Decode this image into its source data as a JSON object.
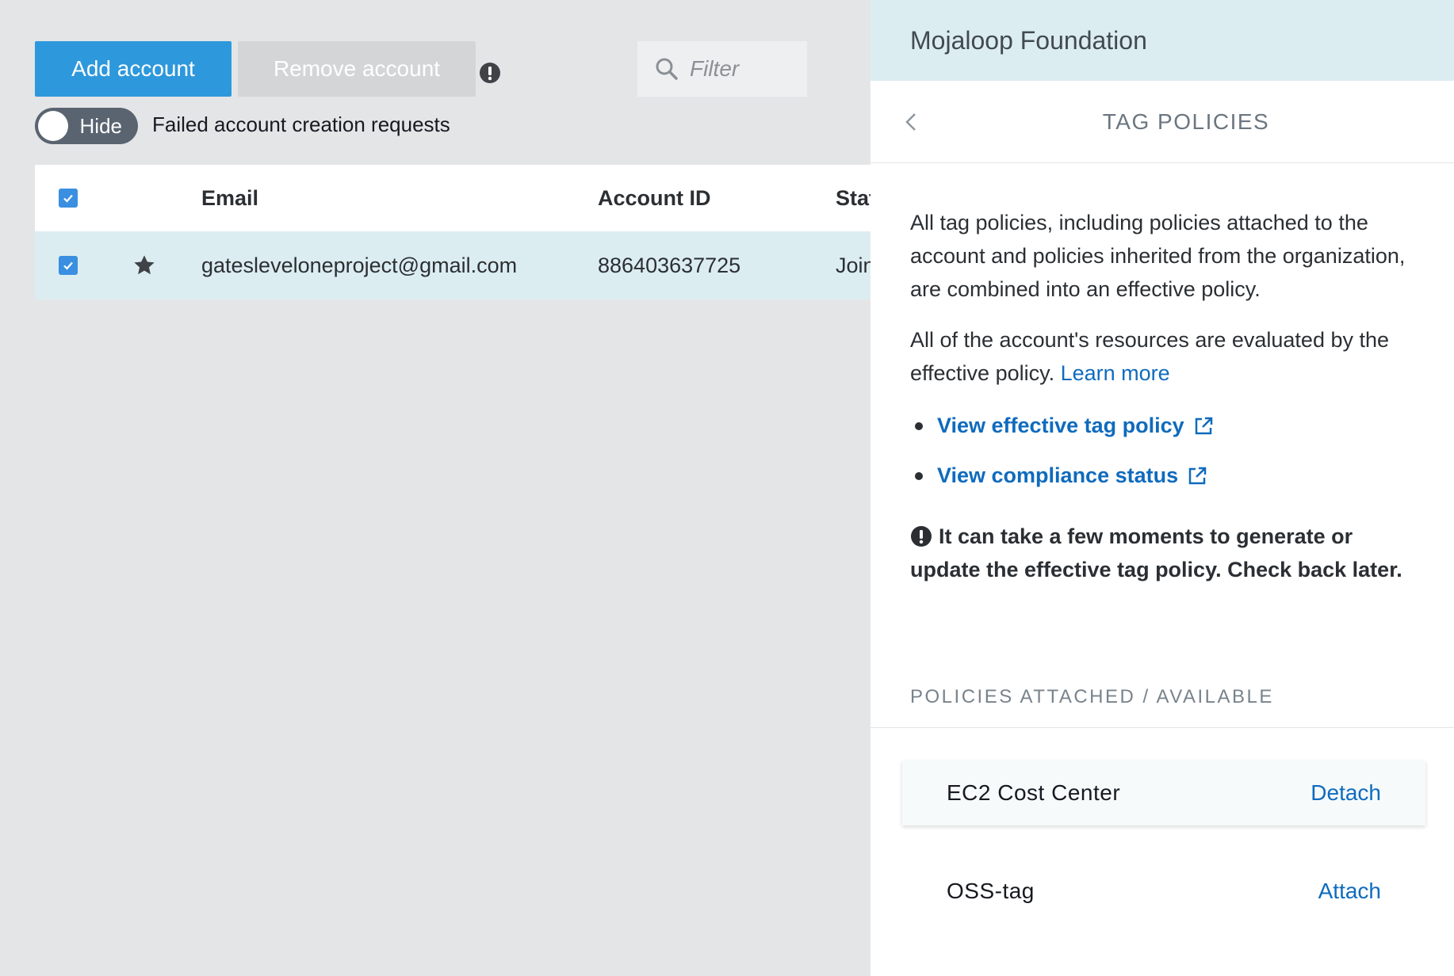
{
  "toolbar": {
    "add_label": "Add account",
    "remove_label": "Remove account",
    "filter_placeholder": "Filter"
  },
  "toggle": {
    "state_label": "Hide",
    "description": "Failed account creation requests"
  },
  "table": {
    "columns": [
      "Email",
      "Account ID",
      "Stat"
    ],
    "rows": [
      {
        "email": "gateslevelоneproject@gmail.com",
        "account_id": "886403637725",
        "status": "Join",
        "selected": true,
        "starred": true
      }
    ]
  },
  "panel": {
    "org_name": "Mojaloop Foundation",
    "title": "TAG POLICIES",
    "para1": "All tag policies, including policies attached to the account and policies inherited from the organization, are combined into an effective policy.",
    "para2": "All of the account's resources are evaluated by the effective policy.",
    "learn_more": "Learn more",
    "links": [
      "View effective tag policy",
      "View compliance status"
    ],
    "note": "It can take a few moments to generate or update the effective tag policy. Check back later.",
    "section_label": "POLICIES ATTACHED / AVAILABLE",
    "policies": [
      {
        "name": "EC2 Cost Center",
        "action": "Detach"
      },
      {
        "name": "OSS-tag",
        "action": "Attach"
      }
    ]
  },
  "colors": {
    "primary": "#2d98dc",
    "link": "#0f6bbd",
    "header_bg": "#dcedf1",
    "selected_row": "#dcedf1"
  }
}
